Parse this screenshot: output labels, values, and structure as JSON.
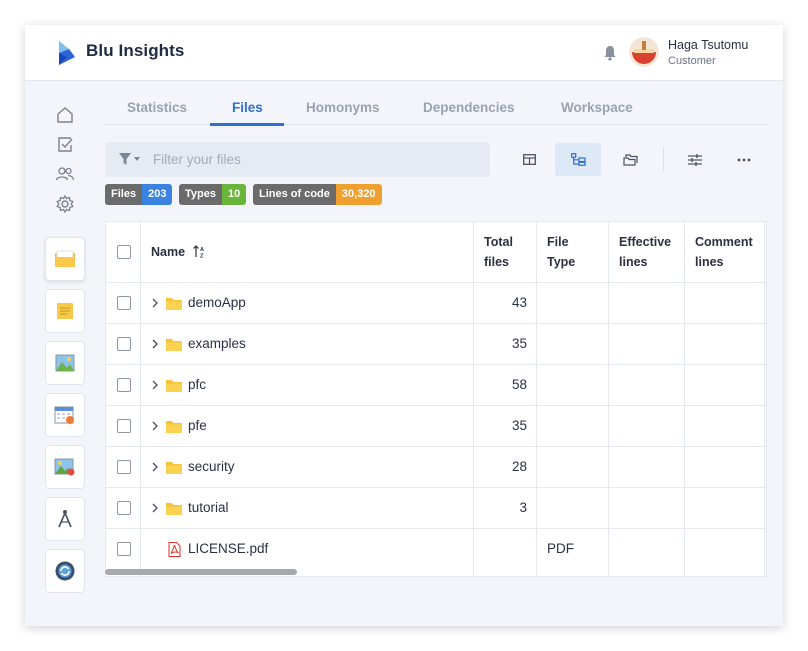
{
  "app": {
    "brand": "Blu Insights"
  },
  "user": {
    "name": "Haga Tsutomu",
    "role": "Customer"
  },
  "tabs": [
    {
      "label": "Statistics",
      "active": false
    },
    {
      "label": "Files",
      "active": true
    },
    {
      "label": "Homonyms",
      "active": false
    },
    {
      "label": "Dependencies",
      "active": false
    },
    {
      "label": "Workspace",
      "active": false
    }
  ],
  "filter": {
    "placeholder": "Filter your files",
    "value": ""
  },
  "badges": [
    {
      "key": "Files",
      "value": "203",
      "color": "#3b83e0"
    },
    {
      "key": "Types",
      "value": "10",
      "color": "#6ab63a"
    },
    {
      "key": "Lines of code",
      "value": "30,320",
      "color": "#f0a02e"
    }
  ],
  "table": {
    "headers": {
      "name": "Name",
      "total_files_1": "Total",
      "total_files_2": "files",
      "file_type_1": "File",
      "file_type_2": "Type",
      "effective_1": "Effective",
      "effective_2": "lines",
      "comment_1": "Comment",
      "comment_2": "lines"
    },
    "rows": [
      {
        "name": "demoApp",
        "total": "43",
        "type": ""
      },
      {
        "name": "examples",
        "total": "35",
        "type": ""
      },
      {
        "name": "pfc",
        "total": "58",
        "type": ""
      },
      {
        "name": "pfe",
        "total": "35",
        "type": ""
      },
      {
        "name": "security",
        "total": "28",
        "type": ""
      },
      {
        "name": "tutorial",
        "total": "3",
        "type": ""
      },
      {
        "name": "LICENSE.pdf",
        "total": "",
        "type": "PDF"
      }
    ]
  },
  "colors": {
    "accent": "#2d6fd2",
    "folder": "#f8c23a",
    "pdf": "#d8342c"
  }
}
